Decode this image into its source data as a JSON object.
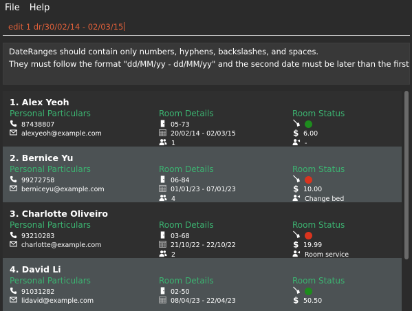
{
  "menu": {
    "file": "File",
    "help": "Help"
  },
  "command": {
    "value": "edit 1 dr/30/02/14 - 02/03/15"
  },
  "result": {
    "line1": "DateRanges should contain only numbers, hyphens, backslashes, and spaces.",
    "line2": "They must follow the format \"dd/MM/yy - dd/MM/yy\" and the second date must be later than the first date."
  },
  "sections": {
    "personal": "Personal Particulars",
    "room": "Room Details",
    "status": "Room Status"
  },
  "colors": {
    "section_heading": "#3cb371",
    "command_text": "#e0603a",
    "status_green": "#1e8c1e",
    "status_red": "#d9341e"
  },
  "persons": [
    {
      "title": "1.  Alex Yeoh",
      "phone": "87438807",
      "email": "alexyeoh@example.com",
      "room": "05-73",
      "dates": "20/02/14 - 02/03/15",
      "guests": "1",
      "status_color": "green",
      "price": "6.00",
      "request": "-"
    },
    {
      "title": "2.  Bernice Yu",
      "phone": "99272758",
      "email": "berniceyu@example.com",
      "room": "06-84",
      "dates": "01/01/23 - 07/01/23",
      "guests": "4",
      "status_color": "red",
      "price": "10.00",
      "request": "Change bed"
    },
    {
      "title": "3.  Charlotte Oliveiro",
      "phone": "93210283",
      "email": "charlotte@example.com",
      "room": "03-68",
      "dates": "21/10/22 - 22/10/22",
      "guests": "2",
      "status_color": "red",
      "price": "19.99",
      "request": "Room service"
    },
    {
      "title": "4.  David Li",
      "phone": "91031282",
      "email": "lidavid@example.com",
      "room": "02-50",
      "dates": "08/04/23 - 22/04/23",
      "guests": "",
      "status_color": "green",
      "price": "50.50",
      "request": ""
    }
  ]
}
